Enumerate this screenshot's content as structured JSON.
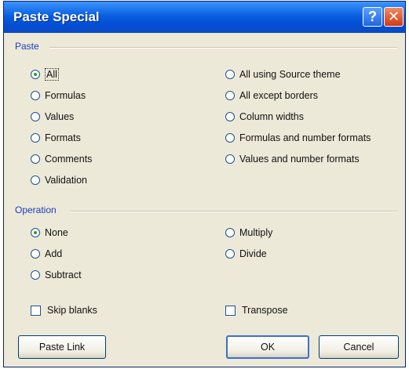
{
  "dialog": {
    "title": "Paste Special",
    "help_label": "?",
    "close_label": "✕"
  },
  "paste": {
    "label": "Paste",
    "options_left": [
      {
        "label": "All",
        "checked": true
      },
      {
        "label": "Formulas",
        "checked": false
      },
      {
        "label": "Values",
        "checked": false
      },
      {
        "label": "Formats",
        "checked": false
      },
      {
        "label": "Comments",
        "checked": false
      },
      {
        "label": "Validation",
        "checked": false
      }
    ],
    "options_right": [
      {
        "label": "All using Source theme",
        "checked": false
      },
      {
        "label": "All except borders",
        "checked": false
      },
      {
        "label": "Column widths",
        "checked": false
      },
      {
        "label": "Formulas and number formats",
        "checked": false
      },
      {
        "label": "Values and number formats",
        "checked": false
      }
    ]
  },
  "operation": {
    "label": "Operation",
    "options_left": [
      {
        "label": "None",
        "checked": true
      },
      {
        "label": "Add",
        "checked": false
      },
      {
        "label": "Subtract",
        "checked": false
      }
    ],
    "options_right": [
      {
        "label": "Multiply",
        "checked": false
      },
      {
        "label": "Divide",
        "checked": false
      }
    ]
  },
  "checks": {
    "skip_blanks": {
      "label": "Skip blanks",
      "checked": false
    },
    "transpose": {
      "label": "Transpose",
      "checked": false
    }
  },
  "buttons": {
    "paste_link": "Paste Link",
    "ok": "OK",
    "cancel": "Cancel"
  }
}
